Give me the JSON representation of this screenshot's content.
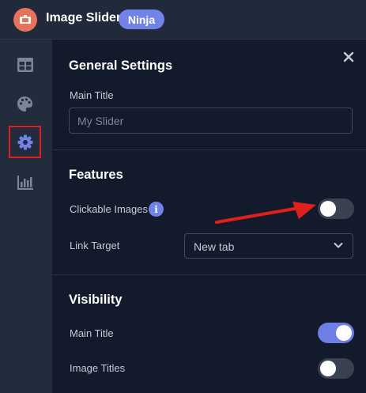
{
  "header": {
    "app_title": "Image Slider",
    "plan_badge": "Ninja",
    "logo_icon": "image-slider-logo-icon"
  },
  "sidebar": {
    "items": [
      {
        "name": "layout",
        "icon": "table-grid-icon",
        "active": false
      },
      {
        "name": "style",
        "icon": "palette-icon",
        "active": false
      },
      {
        "name": "settings",
        "icon": "gear-icon",
        "active": true
      },
      {
        "name": "analytics",
        "icon": "bar-chart-icon",
        "active": false
      }
    ]
  },
  "panel": {
    "close_icon": "close-icon",
    "general": {
      "title": "General Settings",
      "main_title_label": "Main Title",
      "main_title_placeholder": "My Slider",
      "main_title_value": ""
    },
    "features": {
      "title": "Features",
      "clickable_images_label": "Clickable Images",
      "clickable_images_enabled": false,
      "info_icon_glyph": "i",
      "link_target_label": "Link Target",
      "link_target_value": "New tab"
    },
    "visibility": {
      "title": "Visibility",
      "main_title_label": "Main Title",
      "main_title_enabled": true,
      "image_titles_label": "Image Titles",
      "image_titles_enabled": false
    }
  },
  "colors": {
    "accent": "#7283e8",
    "highlight": "#e0201c",
    "panel_bg": "#131a2b",
    "sidebar_bg": "#232c3d"
  }
}
